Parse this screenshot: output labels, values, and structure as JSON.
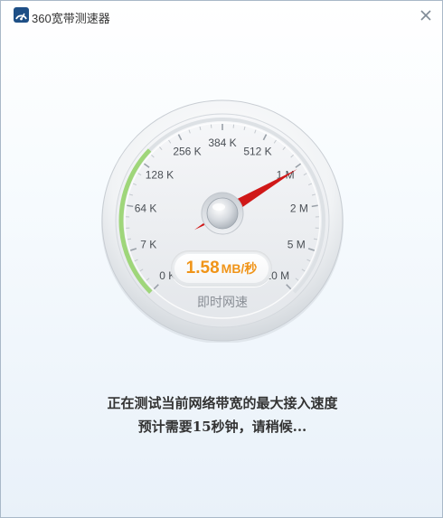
{
  "window": {
    "title": "360宽带测速器",
    "icon": "speedometer-app-icon",
    "close_icon": "close-icon"
  },
  "gauge": {
    "scale_labels": [
      "0 K",
      "7 K",
      "64 K",
      "128 K",
      "256 K",
      "384 K",
      "512 K",
      "1 M",
      "2 M",
      "5 M",
      "10 M"
    ],
    "progress_fraction": 0.33,
    "needle_position_fraction": 0.72,
    "progress_color": "#9fd67a",
    "needle_color": "#d01818"
  },
  "speed": {
    "value": "1.58",
    "unit": "MB/秒",
    "caption": "即时网速",
    "value_color": "#f09418"
  },
  "status": {
    "line1": "正在测试当前网络带宽的最大接入速度",
    "line2": "预计需要15秒钟，请稍候..."
  }
}
